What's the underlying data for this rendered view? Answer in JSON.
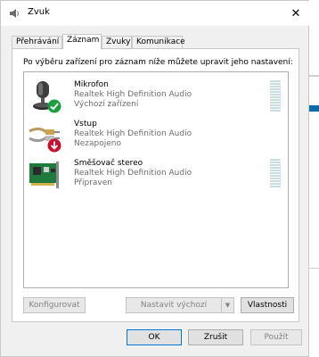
{
  "window": {
    "title": "Zvuk"
  },
  "tabs": [
    {
      "label": "Přehrávání"
    },
    {
      "label": "Záznam"
    },
    {
      "label": "Zvuky"
    },
    {
      "label": "Komunikace"
    }
  ],
  "instruction": "Po výběru zařízení pro záznam níže můžete upravit jeho nastavení:",
  "devices": [
    {
      "name": "Mikrofon",
      "driver": "Realtek High Definition Audio",
      "status": "Výchozí zařízení",
      "icon": "microphone-icon",
      "badge": "default-check-icon"
    },
    {
      "name": "Vstup",
      "driver": "Realtek High Definition Audio",
      "status": "Nezapojeno",
      "icon": "audio-cable-icon",
      "badge": "unplugged-arrow-icon"
    },
    {
      "name": "Směšovač stereo",
      "driver": "Realtek High Definition Audio",
      "status": "Připraven",
      "icon": "sound-card-icon"
    }
  ],
  "buttons": {
    "configure": "Konfigurovat",
    "set_default": "Nastavit výchozí",
    "properties": "Vlastnosti",
    "ok": "OK",
    "cancel": "Zrušit",
    "apply": "Použít"
  },
  "colors": {
    "accent": "#0078d7",
    "check_badge": "#1b9e3e",
    "unplugged_badge": "#c8102e"
  }
}
